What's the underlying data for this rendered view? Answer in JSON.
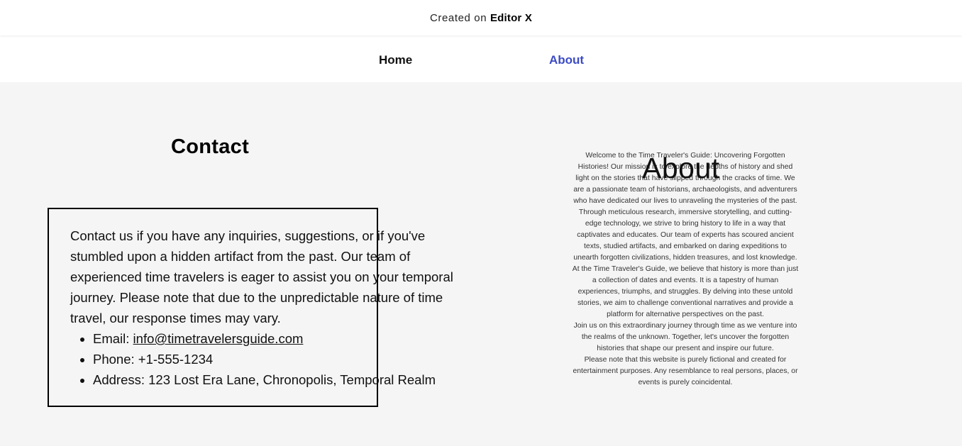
{
  "topbar": {
    "prefix": "Created on",
    "brand": "Editor X"
  },
  "nav": {
    "home": "Home",
    "about": "About",
    "active_color": "#3c4bc4"
  },
  "contact": {
    "title": "Contact",
    "intro": "Contact us if you have any inquiries, suggestions, or if you've stumbled upon a hidden artifact from the past. Our team of experienced time travelers is eager to assist you on your temporal journey. Please note that due to the unpredictable nature of time travel, our response times may vary.",
    "email_label": "Email: ",
    "email": "info@timetravelersguide.com",
    "phone": "Phone: +1-555-1234",
    "address": "Address: 123 Lost Era Lane, Chronopolis, Temporal Realm"
  },
  "about": {
    "heading": "About",
    "paragraphs": [
      "Welcome to the Time Traveler's Guide: Uncovering Forgotten Histories! Our mission is to explore the depths of history and shed light on the stories that have slipped through the cracks of time. We are a passionate team of historians, archaeologists, and adventurers who have dedicated our lives to unraveling the mysteries of the past.",
      "Through meticulous research, immersive storytelling, and cutting-edge technology, we strive to bring history to life in a way that captivates and educates. Our team of experts has scoured ancient texts, studied artifacts, and embarked on daring expeditions to unearth forgotten civilizations, hidden treasures, and lost knowledge.",
      "At the Time Traveler's Guide, we believe that history is more than just a collection of dates and events. It is a tapestry of human experiences, triumphs, and struggles. By delving into these untold stories, we aim to challenge conventional narratives and provide a platform for alternative perspectives on the past.",
      "Join us on this extraordinary journey through time as we venture into the realms of the unknown. Together, let's uncover the forgotten histories that shape our present and inspire our future.",
      "Please note that this website is purely fictional and created for entertainment purposes. Any resemblance to real persons, places, or events is purely coincidental."
    ]
  }
}
